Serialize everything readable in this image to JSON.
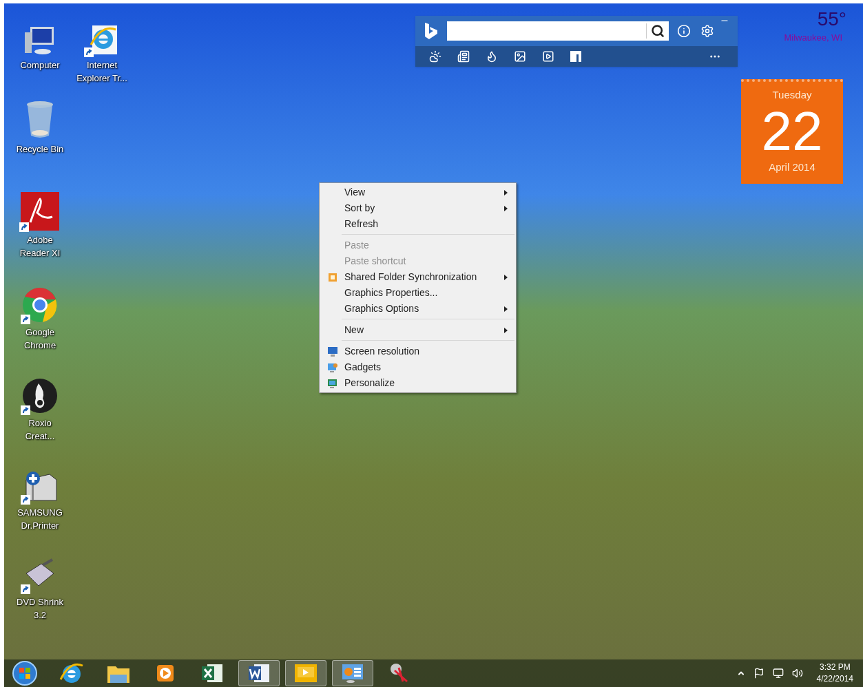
{
  "desktop_icons": [
    {
      "label": "Computer",
      "kind": "computer",
      "shortcut": false
    },
    {
      "label": "Internet Explorer Tr...",
      "kind": "ie",
      "shortcut": true
    },
    {
      "label": "Recycle Bin",
      "kind": "bin",
      "shortcut": false
    },
    {
      "label": "Adobe Reader XI",
      "kind": "pdf",
      "shortcut": true
    },
    {
      "label": "Google Chrome",
      "kind": "chrome",
      "shortcut": true
    },
    {
      "label": "Roxio Creat...",
      "kind": "disc",
      "shortcut": true
    },
    {
      "label": "SAMSUNG Dr.Printer",
      "kind": "printer",
      "shortcut": true
    },
    {
      "label": "DVD Shrink 3.2",
      "kind": "shrink",
      "shortcut": true
    }
  ],
  "weather": {
    "temperature": "55°",
    "location": "Milwaukee, WI"
  },
  "calendar": {
    "weekday": "Tuesday",
    "day": "22",
    "month_year": "April 2014"
  },
  "context_menu": [
    {
      "kind": "item",
      "label": "View",
      "submenu": true,
      "disabled": false
    },
    {
      "kind": "item",
      "label": "Sort by",
      "submenu": true,
      "disabled": false
    },
    {
      "kind": "item",
      "label": "Refresh",
      "submenu": false,
      "disabled": false
    },
    {
      "kind": "separator"
    },
    {
      "kind": "item",
      "label": "Paste",
      "submenu": false,
      "disabled": true
    },
    {
      "kind": "item",
      "label": "Paste shortcut",
      "submenu": false,
      "disabled": true
    },
    {
      "kind": "icon_item",
      "label": "Shared Folder Synchronization",
      "submenu": true,
      "disabled": false
    },
    {
      "kind": "item",
      "label": "Graphics Properties...",
      "submenu": false,
      "disabled": false
    },
    {
      "kind": "item",
      "label": "Graphics Options",
      "submenu": true,
      "disabled": false
    },
    {
      "kind": "separator"
    },
    {
      "kind": "item",
      "label": "New",
      "submenu": true,
      "disabled": false
    },
    {
      "kind": "separator"
    },
    {
      "kind": "icon_item",
      "label": "Screen resolution",
      "submenu": false,
      "disabled": false
    },
    {
      "kind": "icon_item",
      "label": "Gadgets",
      "submenu": false,
      "disabled": false
    },
    {
      "kind": "icon_item",
      "label": "Personalize",
      "submenu": false,
      "disabled": false
    }
  ],
  "taskbar": {
    "apps": [
      {
        "kind": "ie",
        "running": false
      },
      {
        "kind": "folder",
        "running": false
      },
      {
        "kind": "media",
        "running": false
      },
      {
        "kind": "excel",
        "running": false
      },
      {
        "kind": "word",
        "running": true
      },
      {
        "kind": "bing",
        "running": true
      },
      {
        "kind": "panel",
        "running": true
      },
      {
        "kind": "snip",
        "running": false
      }
    ],
    "clock": {
      "time": "3:32 PM",
      "date": "4/22/2014"
    }
  }
}
